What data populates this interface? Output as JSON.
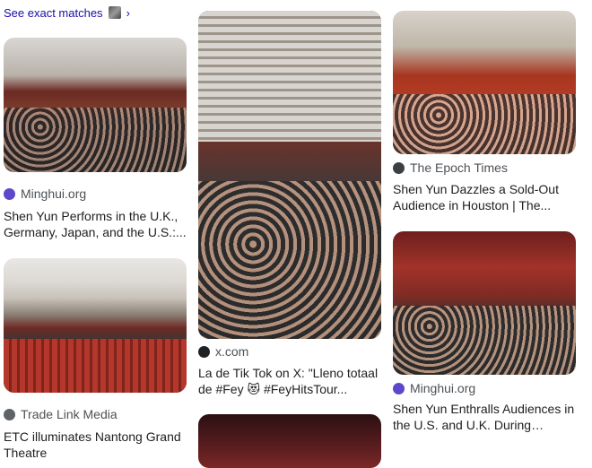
{
  "top_link": {
    "label": "See exact matches",
    "chevron": "›"
  },
  "results": [
    {
      "source": "Minghui.org",
      "favicon_color": "#5b49c9",
      "title": "Shen Yun Performs in the U.K., Germany, Japan, and the U.S.:..."
    },
    {
      "source": "Trade Link Media",
      "favicon_color": "#5f6368",
      "title": "ETC illuminates Nantong Grand Theatre"
    },
    {
      "source": "x.com",
      "favicon_color": "#202124",
      "title": "La de Tik Tok on X: \"Lleno totaal de #Fey 😻 #FeyHitsTour..."
    },
    {
      "source": "The Epoch Times",
      "favicon_color": "#3c4043",
      "title": "Shen Yun Dazzles a Sold-Out Audience in Houston | The..."
    },
    {
      "source": "Minghui.org",
      "favicon_color": "#5b49c9",
      "title": "Shen Yun Enthralls Audiences in the U.S. and U.K. During Chines..."
    }
  ]
}
